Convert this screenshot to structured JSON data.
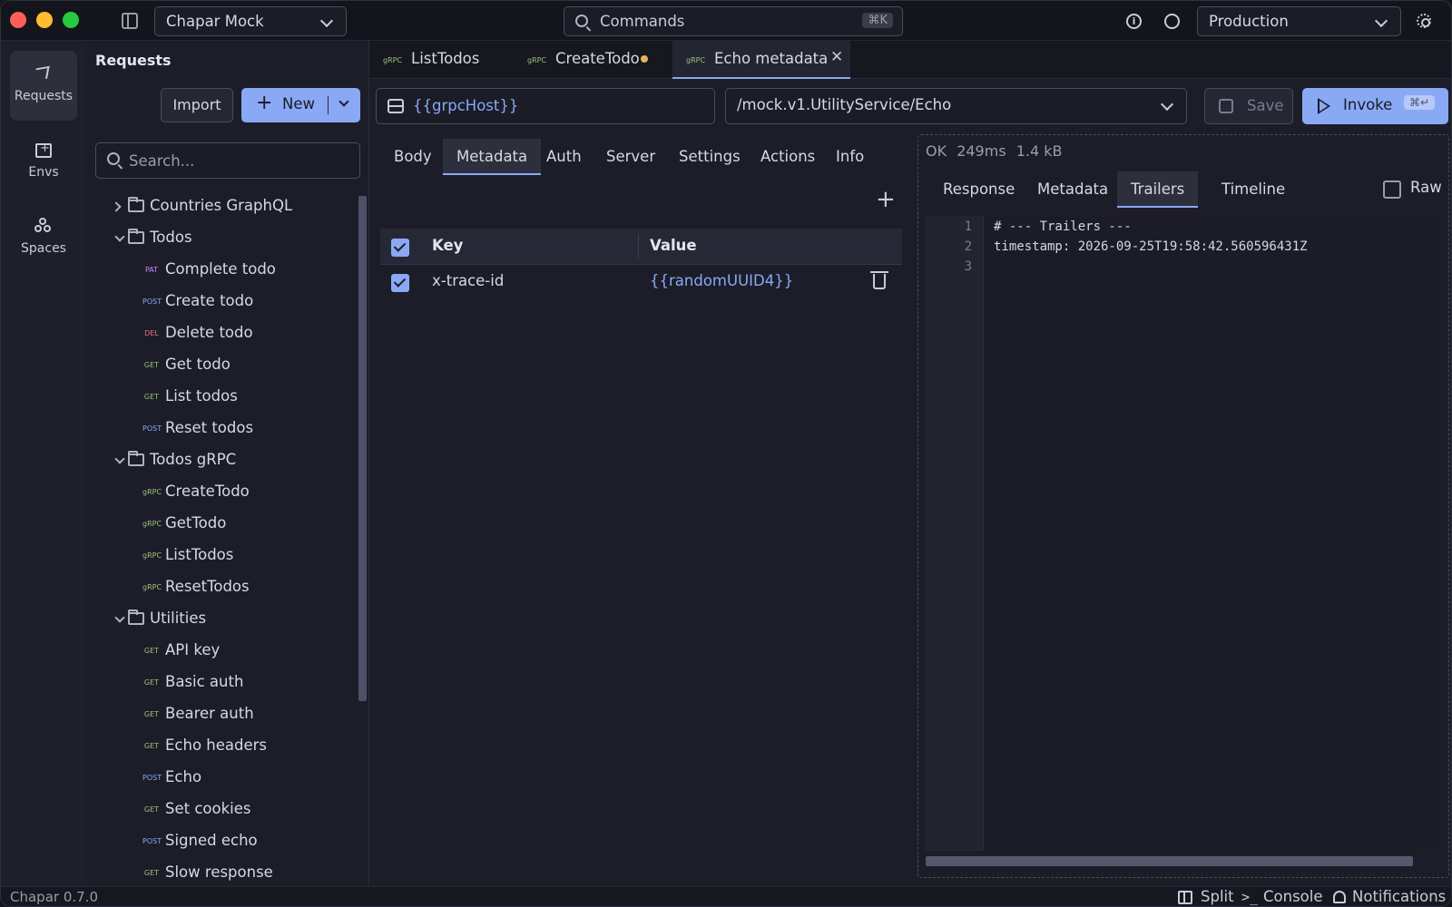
{
  "titlebar": {
    "workspace": "Chapar Mock",
    "commands_label": "Commands",
    "commands_shortcut": "⌘K",
    "environment": "Production"
  },
  "rail": {
    "items": [
      {
        "label": "Requests",
        "icon": "send-icon",
        "active": true
      },
      {
        "label": "Envs",
        "icon": "folder-plus-icon",
        "active": false
      },
      {
        "label": "Spaces",
        "icon": "spaces-icon",
        "active": false
      }
    ]
  },
  "requests_panel": {
    "title": "Requests",
    "import_label": "Import",
    "new_label": "New",
    "search_placeholder": "Search...",
    "tree": [
      {
        "type": "folder",
        "label": "Countries GraphQL",
        "open": false
      },
      {
        "type": "folder",
        "label": "Todos",
        "open": true
      },
      {
        "type": "request",
        "method": "PAT",
        "label": "Complete todo"
      },
      {
        "type": "request",
        "method": "POST",
        "label": "Create todo"
      },
      {
        "type": "request",
        "method": "DEL",
        "label": "Delete todo"
      },
      {
        "type": "request",
        "method": "GET",
        "label": "Get todo"
      },
      {
        "type": "request",
        "method": "GET",
        "label": "List todos"
      },
      {
        "type": "request",
        "method": "POST",
        "label": "Reset todos"
      },
      {
        "type": "folder",
        "label": "Todos gRPC",
        "open": true
      },
      {
        "type": "request",
        "method": "gRPC",
        "label": "CreateTodo"
      },
      {
        "type": "request",
        "method": "gRPC",
        "label": "GetTodo"
      },
      {
        "type": "request",
        "method": "gRPC",
        "label": "ListTodos"
      },
      {
        "type": "request",
        "method": "gRPC",
        "label": "ResetTodos"
      },
      {
        "type": "folder",
        "label": "Utilities",
        "open": true
      },
      {
        "type": "request",
        "method": "GET",
        "label": "API key"
      },
      {
        "type": "request",
        "method": "GET",
        "label": "Basic auth"
      },
      {
        "type": "request",
        "method": "GET",
        "label": "Bearer auth"
      },
      {
        "type": "request",
        "method": "GET",
        "label": "Echo headers"
      },
      {
        "type": "request",
        "method": "POST",
        "label": "Echo"
      },
      {
        "type": "request",
        "method": "GET",
        "label": "Set cookies"
      },
      {
        "type": "request",
        "method": "POST",
        "label": "Signed echo"
      },
      {
        "type": "request",
        "method": "GET",
        "label": "Slow response"
      }
    ],
    "method_colors": {
      "GET": "#9fc07a",
      "POST": "#8aa9f5",
      "DEL": "#e8717e",
      "PAT": "#c58af0",
      "gRPC": "#9fc07a"
    }
  },
  "tabs": [
    {
      "method": "gRPC",
      "label": "ListTodos",
      "active": false,
      "dirty": false
    },
    {
      "method": "gRPC",
      "label": "CreateTodo",
      "active": false,
      "dirty": true
    },
    {
      "method": "gRPC",
      "label": "Echo metadata",
      "active": true,
      "dirty": false
    }
  ],
  "request": {
    "host": "{{grpcHost}}",
    "method_path": "/mock.v1.UtilityService/Echo",
    "save_label": "Save",
    "invoke_label": "Invoke",
    "invoke_shortcut": "⌘↵",
    "sub_tabs": [
      "Body",
      "Metadata",
      "Auth",
      "Server",
      "Settings",
      "Actions",
      "Info"
    ],
    "active_sub_tab": "Metadata",
    "metadata_table": {
      "headers": {
        "key": "Key",
        "value": "Value"
      },
      "rows": [
        {
          "enabled": true,
          "key": "x-trace-id",
          "value": "{{randomUUID4}}"
        }
      ]
    }
  },
  "response": {
    "status": "OK",
    "time": "249ms",
    "size": "1.4 kB",
    "tabs": [
      "Response",
      "Metadata",
      "Trailers",
      "Timeline"
    ],
    "active_tab": "Trailers",
    "raw_label": "Raw",
    "lines": [
      {
        "n": "1",
        "text": "# --- Trailers ---"
      },
      {
        "n": "2",
        "text": "timestamp: 2026-09-25T19:58:42.560596431Z"
      },
      {
        "n": "3",
        "text": ""
      }
    ]
  },
  "statusbar": {
    "version": "Chapar 0.7.0",
    "split_label": "Split",
    "console_label": "Console",
    "notifications_label": "Notifications"
  },
  "colors": {
    "accent": "#8aa9f5",
    "dirty_dot": "#e6b35a"
  }
}
